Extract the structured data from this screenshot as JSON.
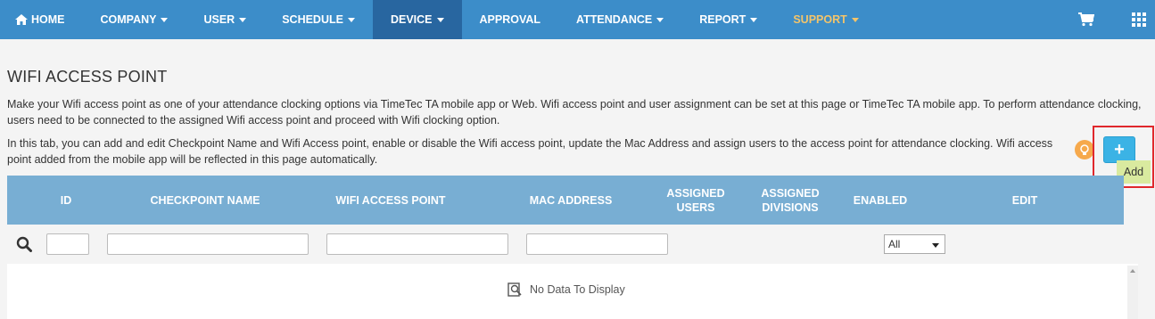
{
  "nav": {
    "items": [
      {
        "label": "HOME",
        "icon": "home-icon",
        "dropdown": false
      },
      {
        "label": "COMPANY",
        "dropdown": true
      },
      {
        "label": "USER",
        "dropdown": true
      },
      {
        "label": "SCHEDULE",
        "dropdown": true
      },
      {
        "label": "DEVICE",
        "dropdown": true,
        "active": true
      },
      {
        "label": "APPROVAL",
        "dropdown": false
      },
      {
        "label": "ATTENDANCE",
        "dropdown": true
      },
      {
        "label": "REPORT",
        "dropdown": true
      },
      {
        "label": "SUPPORT",
        "dropdown": true
      }
    ],
    "right_icons": [
      "cart-icon",
      "apps-grid-icon"
    ],
    "colors": {
      "bar": "#3c8dc9",
      "active": "#2866a0",
      "support": "#f2c46b"
    }
  },
  "page": {
    "title": "WIFI ACCESS POINT",
    "description1": "Make your Wifi access point as one of your attendance clocking options via TimeTec TA mobile app or Web. Wifi access point and user assignment can be set at this page or TimeTec TA mobile app. To perform attendance clocking, users need to be connected to the assigned Wifi access point and proceed with Wifi clocking option.",
    "description2": "In this tab, you can add and edit Checkpoint Name and Wifi Access point, enable or disable the Wifi access point, update the Mac Address and assign users to the access point for attendance clocking. Wifi access point added from the mobile app will be reflected in this page automatically."
  },
  "add": {
    "symbol": "+",
    "tooltip": "Add",
    "help_icon": "lightbulb-icon"
  },
  "table": {
    "columns": [
      "ID",
      "CHECKPOINT NAME",
      "WIFI ACCESS POINT",
      "MAC ADDRESS",
      "ASSIGNED\nUSERS",
      "ASSIGNED\nDIVISIONS",
      "ENABLED",
      "EDIT"
    ],
    "columns_display": {
      "id": "ID",
      "checkpoint": "CHECKPOINT NAME",
      "wifi": "WIFI ACCESS POINT",
      "mac": "MAC ADDRESS",
      "assigned_users_1": "ASSIGNED",
      "assigned_users_2": "USERS",
      "assigned_divisions_1": "ASSIGNED",
      "assigned_divisions_2": "DIVISIONS",
      "enabled": "ENABLED",
      "edit": "EDIT"
    },
    "filters": {
      "id": "",
      "checkpoint": "",
      "wifi": "",
      "mac": "",
      "enabled_selected": "All"
    },
    "empty_text": "No Data To Display"
  }
}
